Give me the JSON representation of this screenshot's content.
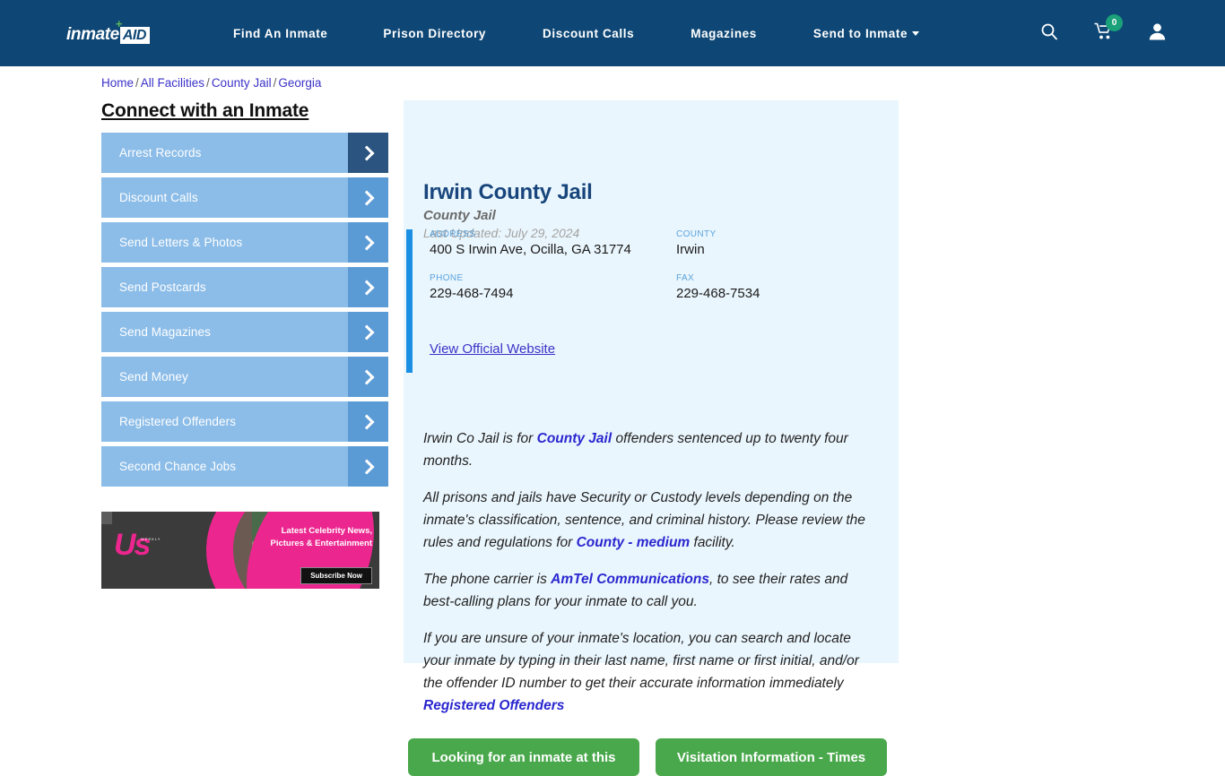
{
  "header": {
    "logo": {
      "word": "inmate",
      "badge": "AID",
      "plus": "+"
    },
    "nav": [
      {
        "label": "Find An Inmate"
      },
      {
        "label": "Prison Directory"
      },
      {
        "label": "Discount Calls"
      },
      {
        "label": "Magazines"
      },
      {
        "label": "Send to Inmate"
      }
    ],
    "icons": {
      "search": "search-icon",
      "cart": "cart-icon",
      "cart_count": "0",
      "account": "user-account-icon"
    },
    "bg_color": "#0e4775",
    "badge_color": "#1aa179"
  },
  "breadcrumb": {
    "items": [
      "Home",
      "All Facilities",
      "County Jail",
      "Georgia"
    ],
    "separator": "/"
  },
  "sidebar": {
    "title": "Connect with an Inmate",
    "items": [
      {
        "label": "Arrest Records",
        "active": true
      },
      {
        "label": "Discount Calls",
        "active": false
      },
      {
        "label": "Send Letters & Photos",
        "active": false
      },
      {
        "label": "Send Postcards",
        "active": false
      },
      {
        "label": "Send Magazines",
        "active": false
      },
      {
        "label": "Send Money",
        "active": false
      },
      {
        "label": "Registered Offenders",
        "active": false
      },
      {
        "label": "Second Chance Jobs",
        "active": false
      }
    ],
    "button_color": "#8cbde8",
    "arrow_color": "#5b9bd5",
    "arrow_active_color": "#2b5580"
  },
  "ad": {
    "logo": "Us",
    "logo_sub": "WEEKLY",
    "headline": "Latest Celebrity News, Pictures & Entertainment",
    "cta": "Subscribe Now"
  },
  "facility": {
    "title": "Irwin County Jail",
    "subtitle": "County Jail",
    "last_updated": "Last Updated: July 29, 2024",
    "info": [
      {
        "label": "ADDRESS",
        "value": "400 S Irwin Ave, Ocilla, GA 31774"
      },
      {
        "label": "COUNTY",
        "value": "Irwin"
      },
      {
        "label": "PHONE",
        "value": "229-468-7494"
      },
      {
        "label": "FAX",
        "value": "229-468-7534"
      }
    ],
    "website_link": "View Official Website",
    "accent_color": "#1a8fe3",
    "card_bg": "#eaf6fd",
    "paragraphs": [
      {
        "parts": [
          {
            "t": "Irwin Co Jail is for ",
            "b": false
          },
          {
            "t": "County Jail",
            "b": true
          },
          {
            "t": " offenders sentenced up to twenty four months.",
            "b": false
          }
        ]
      },
      {
        "parts": [
          {
            "t": "All prisons and jails have Security or Custody levels depending on the inmate's classification, sentence, and criminal history. Please review the rules and regulations for ",
            "b": false
          },
          {
            "t": "County - medium",
            "b": true
          },
          {
            "t": " facility.",
            "b": false
          }
        ]
      },
      {
        "parts": [
          {
            "t": "The phone carrier is ",
            "b": false
          },
          {
            "t": "AmTel Communications",
            "b": true
          },
          {
            "t": ", to see their rates and best-calling plans for your inmate to call you.",
            "b": false
          }
        ]
      },
      {
        "parts": [
          {
            "t": "If you are unsure of your inmate's location, you can search and locate your inmate by typing in their last name, first name or first initial, and/or the offender ID number to get their accurate information immediately ",
            "b": false
          },
          {
            "t": "Registered Offenders",
            "b": true
          }
        ]
      }
    ]
  },
  "cta_buttons": [
    {
      "label": "Looking for an inmate at this"
    },
    {
      "label": "Visitation Information - Times"
    }
  ],
  "cta_color": "#49a84b"
}
